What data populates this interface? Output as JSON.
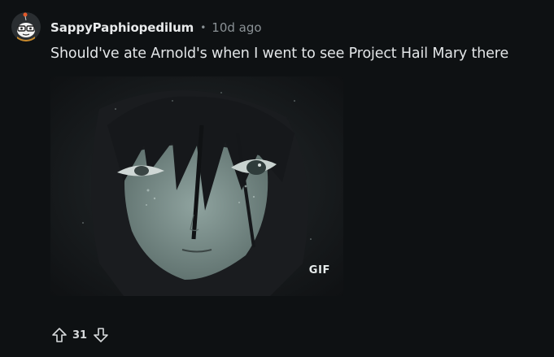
{
  "comment": {
    "author": "SappyPaphiopedilum",
    "separator": "•",
    "age": "10d ago",
    "text": "Should've ate Arnold's when I went to see Project Hail Mary there",
    "media": {
      "badge": "GIF"
    },
    "votes": {
      "score": "31"
    }
  },
  "icons": {
    "avatar": "snoo-avatar-icon",
    "upvote": "upvote-arrow-icon",
    "downvote": "downvote-arrow-icon"
  },
  "colors": {
    "background": "#0e1113",
    "text": "#d7dadc",
    "muted": "#8b9296"
  }
}
